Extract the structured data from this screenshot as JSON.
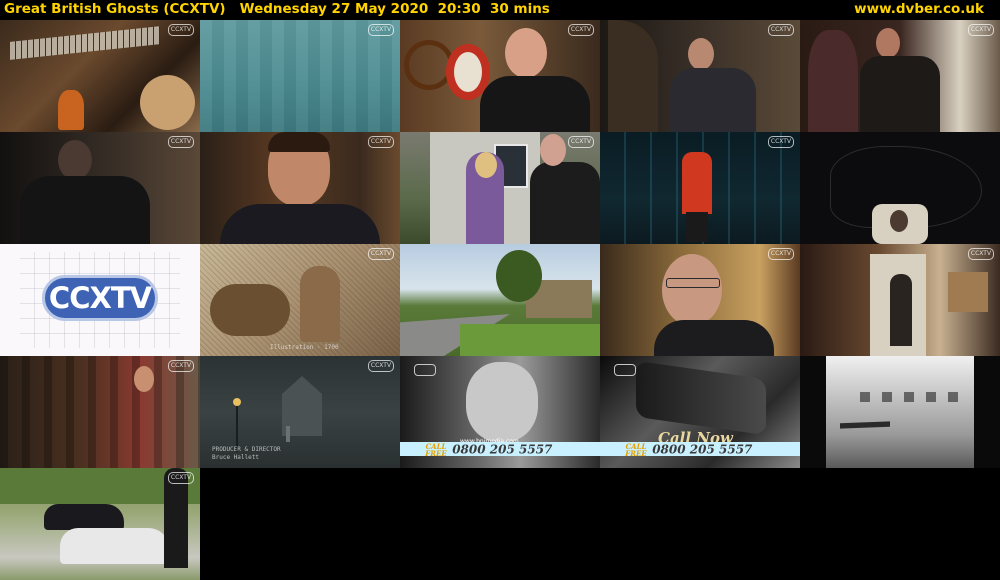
{
  "header": {
    "title": "Great British Ghosts (CCXTV)   Wednesday 27 May 2020  20:30  30 mins",
    "site": "www.dvber.co.uk"
  },
  "channel_logo": "CCXTV",
  "captions": {
    "engraving": "Illustration · 1700",
    "credit": "PRODUCER & DIRECTOR",
    "credit_name": "Bruce Hallett",
    "callnow": "Call Now",
    "url": "www.bnimedia.com",
    "call_free": "CALL FREE",
    "phone": "0800 205 5557"
  }
}
